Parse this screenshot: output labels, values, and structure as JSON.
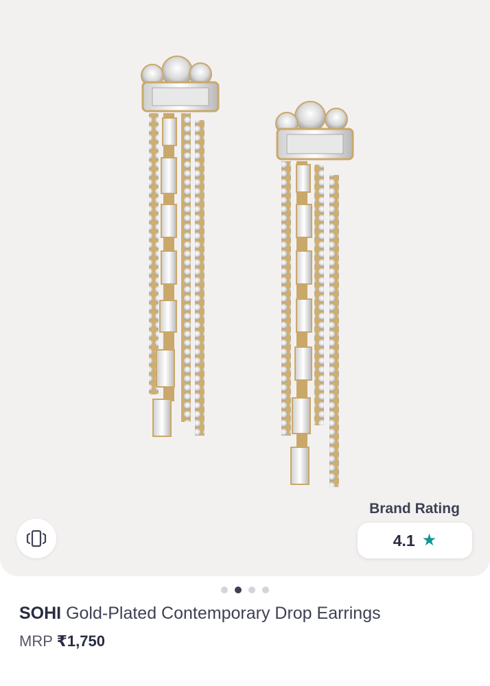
{
  "product": {
    "brand": "SOHI",
    "name": "Gold-Plated Contemporary Drop Earrings",
    "mrp_label": "MRP",
    "price": "₹1,750"
  },
  "rating": {
    "title": "Brand Rating",
    "value": "4.1",
    "star_icon": "star-icon",
    "star_color": "#14958f"
  },
  "gallery": {
    "image_count": 4,
    "active_index": 1,
    "view_similar_icon": "view-similar-icon"
  },
  "colors": {
    "gallery_bg": "#f3f0f0",
    "text_primary": "#282c3f",
    "text_secondary": "#3e4152"
  }
}
